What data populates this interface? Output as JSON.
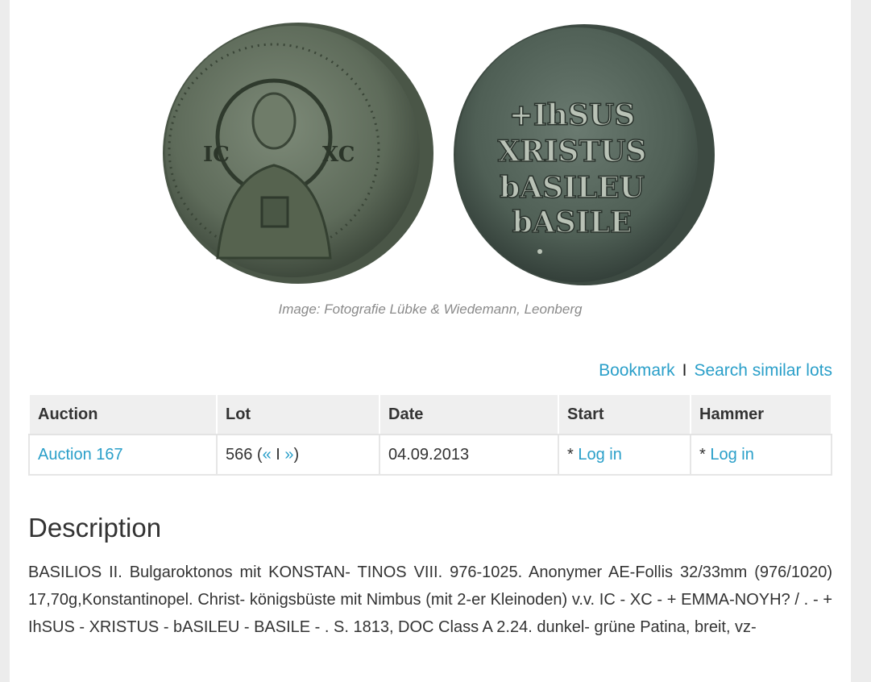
{
  "image": {
    "caption": "Image: Fotografie Lübke & Wiedemann, Leonberg",
    "obverse_legend_left": "IC",
    "obverse_legend_right": "XC",
    "reverse_lines": [
      "+IhSUS",
      "XRISTUS",
      "bASILEU",
      "bASILE"
    ]
  },
  "actions": {
    "bookmark": "Bookmark",
    "separator": "I",
    "search_similar": "Search similar lots"
  },
  "table": {
    "headers": [
      "Auction",
      "Lot",
      "Date",
      "Start",
      "Hammer"
    ],
    "row": {
      "auction": "Auction 167",
      "lot_number": "566",
      "lot_open": " (",
      "lot_prev": "«",
      "lot_sep": " I ",
      "lot_next": "»",
      "lot_close": ")",
      "date": "04.09.2013",
      "start_prefix": "* ",
      "start_link": "Log in",
      "hammer_prefix": "* ",
      "hammer_link": "Log in"
    }
  },
  "description": {
    "title": "Description",
    "text": "BASILIOS II. Bulgaroktonos mit KONSTAN- TINOS VIII. 976-1025. Anonymer AE-Follis 32/33mm (976/1020) 17,70g,Konstantinopel. Christ- königsbüste mit Nimbus (mit 2-er Kleinoden) v.v. IC - XC - + EMMA-NOYH? / . - + IhSUS - XRISTUS - bASILEU - BASILE - . S. 1813, DOC Class A 2.24. dunkel- grüne Patina, breit, vz-"
  }
}
